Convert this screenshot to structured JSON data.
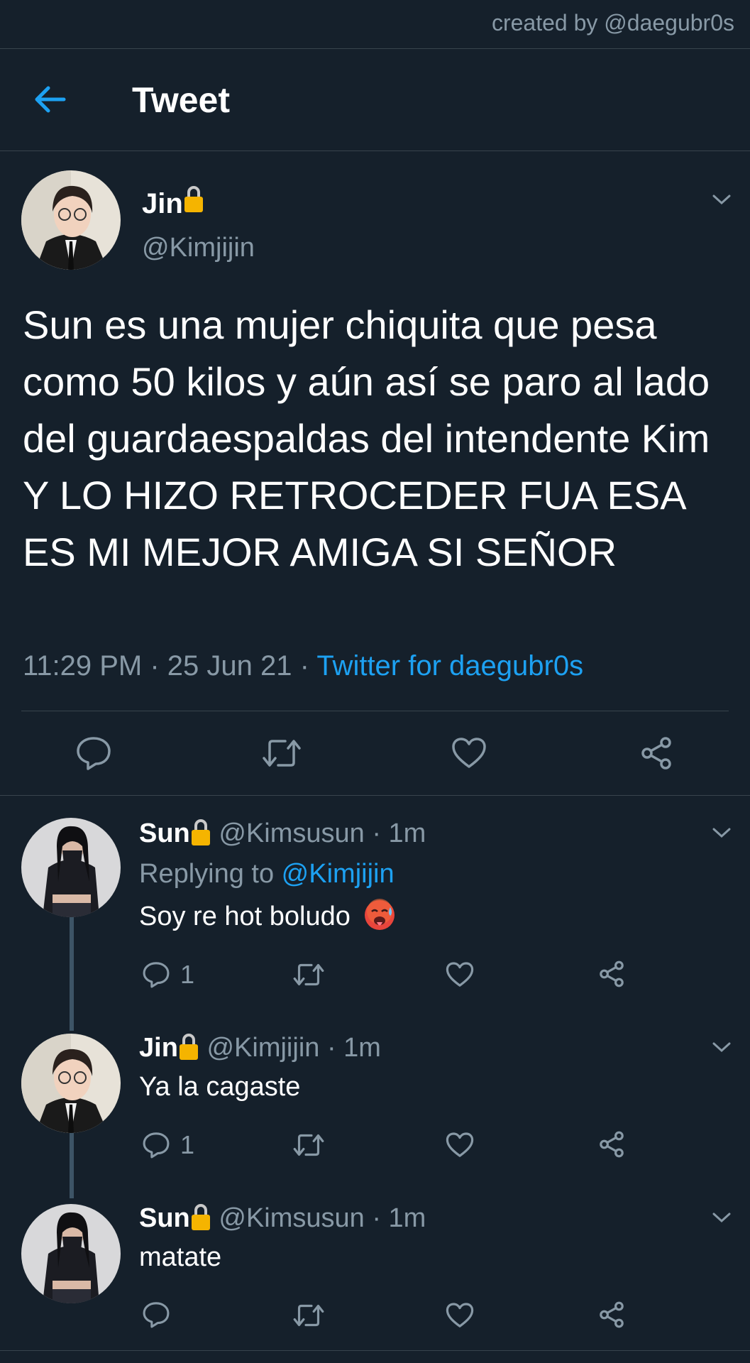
{
  "credit": "created by @daegubr0s",
  "header": {
    "title": "Tweet"
  },
  "main_tweet": {
    "name": "Jin",
    "handle": "@Kimjijin",
    "text": "Sun es una mujer chiquita que pesa como 50 kilos y aún así se paro al lado del guardaespaldas del intendente Kim Y LO HIZO RETROCEDER FUA ESA ES MI MEJOR AMIGA SI SEÑOR",
    "time": "11:29 PM · 25 Jun 21 · ",
    "source": "Twitter for daegubr0s"
  },
  "replies": [
    {
      "name": "Sun",
      "handle_time": "@Kimsusun · 1m",
      "replying_prefix": "Replying to ",
      "replying_to": "@Kimjijin",
      "text": "Soy re hot boludo",
      "emoji": "hot-face-emoji",
      "reply_count": "1"
    },
    {
      "name": "Jin",
      "handle_time": "@Kimjijin · 1m",
      "text": "Ya la cagaste",
      "reply_count": "1"
    },
    {
      "name": "Sun",
      "handle_time": "@Kimsusun · 1m",
      "text": "matate",
      "reply_count": ""
    }
  ],
  "icons": {
    "back": "arrow-left-icon",
    "lock": "lock-icon",
    "chevron": "chevron-down-icon",
    "reply": "reply-icon",
    "retweet": "retweet-icon",
    "like": "heart-icon",
    "share": "share-icon"
  },
  "colors": {
    "background": "#15202b",
    "text": "#ffffff",
    "muted": "#8899a6",
    "accent": "#1da1f2",
    "divider": "#38444d",
    "lock": "#f5b400"
  }
}
